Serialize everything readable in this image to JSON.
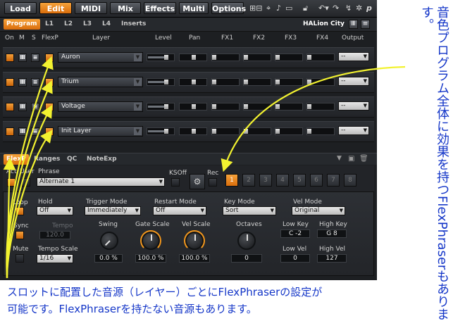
{
  "toolbar": {
    "buttons": [
      "Load",
      "Edit",
      "MIDI",
      "Mix",
      "Effects",
      "Multi",
      "Options"
    ]
  },
  "tabs": {
    "items": [
      "Program",
      "L1",
      "L2",
      "L3",
      "L4",
      "Inserts"
    ],
    "program_name": "HALion City"
  },
  "headers": {
    "on": "On",
    "m": "M",
    "s": "S",
    "flexp": "FlexP",
    "layer": "Layer",
    "level": "Level",
    "pan": "Pan",
    "fx1": "FX1",
    "fx2": "FX2",
    "fx3": "FX3",
    "fx4": "FX4",
    "output": "Output"
  },
  "layers": [
    {
      "name": "Auron",
      "output": "--",
      "level": 0.75
    },
    {
      "name": "Trium",
      "output": "--",
      "level": 0.75
    },
    {
      "name": "Voltage",
      "output": "--",
      "level": 0.75
    },
    {
      "name": "Init Layer",
      "output": "--",
      "level": 0.75
    }
  ],
  "editor_tabs": [
    "FlexP",
    "Ranges",
    "QC",
    "NoteExp"
  ],
  "flexp": {
    "act": "Act",
    "user": "User",
    "phrase_label": "Phrase",
    "phrase": "Alternate 1",
    "ksoff": "KSOff",
    "rec": "Rec",
    "slots": [
      "1",
      "2",
      "3",
      "4",
      "5",
      "6",
      "7",
      "8"
    ],
    "loop": "Loop",
    "sync": "Sync",
    "mute": "Mute",
    "hold_label": "Hold",
    "hold": "Off",
    "tempo_label": "Tempo",
    "tempo": "120.0",
    "tempo_scale_label": "Tempo Scale",
    "tempo_scale": "1/16",
    "trigger_mode_label": "Trigger Mode",
    "trigger_mode": "Immediately",
    "restart_mode_label": "Restart Mode",
    "restart_mode": "Off",
    "key_mode_label": "Key Mode",
    "key_mode": "Sort",
    "vel_mode_label": "Vel Mode",
    "vel_mode": "Original",
    "swing_label": "Swing",
    "swing": "0.0 %",
    "gate_scale_label": "Gate Scale",
    "gate_scale": "100.0 %",
    "vel_scale_label": "Vel Scale",
    "vel_scale": "100.0 %",
    "octaves_label": "Octaves",
    "octaves": "0",
    "low_key_label": "Low Key",
    "low_key": "C -2",
    "high_key_label": "High Key",
    "high_key": "G 8",
    "low_vel_label": "Low Vel",
    "low_vel": "0",
    "high_vel_label": "High Vel",
    "high_vel": "127"
  },
  "annotations": {
    "vertical": "音色プログラム全体に効果を持つFlexPhraserもあります。",
    "bottom_line1": "スロットに配置した音源（レイヤー）ごとにFlexPhraserの設定が",
    "bottom_line2": "可能です。FlexPhraserを持たない音源もあります。"
  },
  "colors": {
    "accent": "#f2971d",
    "annotation": "#1436c8",
    "arrow": "#f2f230"
  }
}
